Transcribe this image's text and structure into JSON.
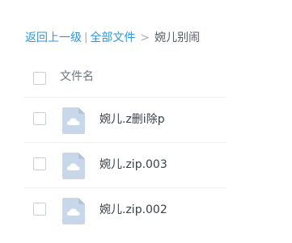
{
  "breadcrumb": {
    "back_label": "返回上一级",
    "separator_bar": "|",
    "all_files_label": "全部文件",
    "separator_arrow": ">",
    "current_folder": "婉儿别闹"
  },
  "list_header": {
    "name_label": "文件名"
  },
  "files": [
    {
      "name": "婉儿.z删i除p",
      "icon": "cloud-file-icon"
    },
    {
      "name": "婉儿.zip.003",
      "icon": "cloud-file-icon"
    },
    {
      "name": "婉儿.zip.002",
      "icon": "cloud-file-icon"
    }
  ],
  "colors": {
    "link": "#2e96e0",
    "icon_bg": "#c8d8ea",
    "text": "#3b4148"
  }
}
